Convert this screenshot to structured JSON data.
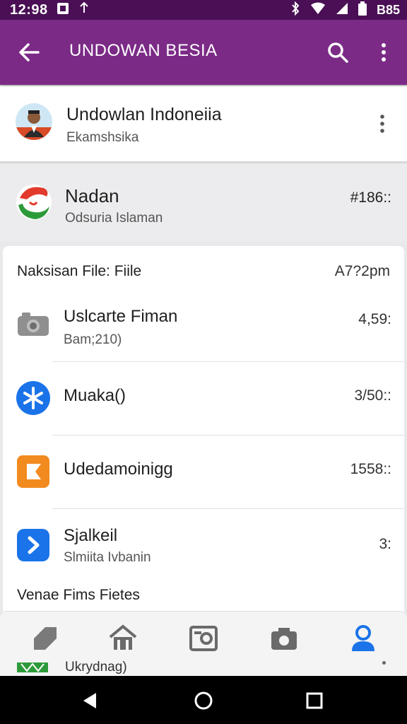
{
  "status_bar": {
    "time": "12:98",
    "battery_text": "B85"
  },
  "app_bar": {
    "title": "UNDOWAN BESIA"
  },
  "account_card": {
    "name": "Undowlan Indoneiia",
    "subtitle": "Ekamshsika"
  },
  "group_card": {
    "name": "Nadan",
    "subtitle": "Odsuria Islaman",
    "count": "#186::"
  },
  "files_panel": {
    "header": "Naksisan File: Fiile",
    "time": "A7?2pm",
    "items": [
      {
        "name": "Uslcarte Fiman",
        "sub": "Bam;210)",
        "value": "4,59:",
        "icon": "camera-icon"
      },
      {
        "name": "Muaka()",
        "sub": "",
        "value": "3/50::",
        "icon": "asterisk-icon"
      },
      {
        "name": "Udedamoinigg",
        "sub": "",
        "value": "1558::",
        "icon": "flag-icon"
      },
      {
        "name": "Sjalkeil",
        "sub": "Slmiita Ivbanin",
        "value": "3:",
        "icon": "chevron-icon"
      }
    ],
    "footer_label": "Venae Fims Fietes"
  },
  "bottom_nav": {
    "items": [
      "tag-icon",
      "home-icon",
      "document-icon",
      "camera-icon",
      "profile-icon"
    ],
    "active": "profile-icon",
    "label": "Ukrydnag)"
  },
  "colors": {
    "primary": "#7b2a86",
    "status": "#4a0f55",
    "accent": "#1a73e8"
  }
}
